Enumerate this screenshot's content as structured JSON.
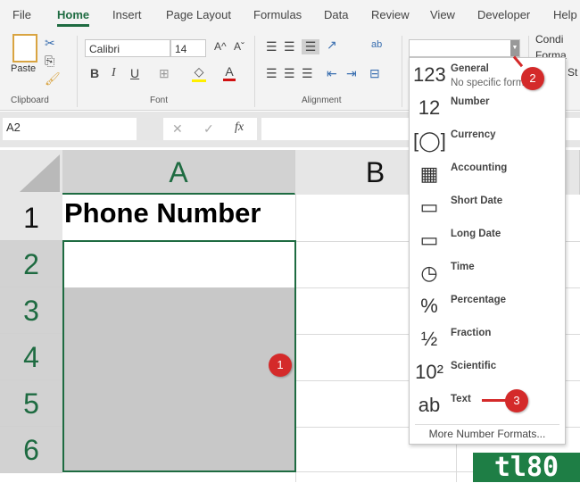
{
  "tabs": [
    "File",
    "Home",
    "Insert",
    "Page Layout",
    "Formulas",
    "Data",
    "Review",
    "View",
    "Developer",
    "Help"
  ],
  "clipboard": {
    "paste": "Paste",
    "label": "Clipboard"
  },
  "font": {
    "name": "Calibri",
    "size": "14",
    "label": "Font",
    "bold": "B",
    "italic": "I",
    "underline": "U",
    "grow": "A^",
    "shrink": "Aˇ",
    "color_glyph": "A"
  },
  "alignment": {
    "label": "Alignment",
    "wrap": "ab"
  },
  "styles": {
    "conditional": "Condi",
    "format": "Forma",
    "cell": "St"
  },
  "formula_bar": {
    "name_box": "A2",
    "cancel": "✕",
    "enter": "✓",
    "fx": "fx",
    "value": ""
  },
  "columns": [
    "A",
    "B"
  ],
  "rows": [
    "1",
    "2",
    "3",
    "4",
    "5",
    "6"
  ],
  "cells": {
    "A1": "Phone Number"
  },
  "number_format": {
    "value": "",
    "items": [
      {
        "icon": "general-123",
        "glyph": "123",
        "label": "General",
        "sub": "No specific format"
      },
      {
        "icon": "number-12",
        "glyph": "12",
        "label": "Number"
      },
      {
        "icon": "currency",
        "glyph": "[◯]",
        "label": "Currency"
      },
      {
        "icon": "accounting",
        "glyph": "▦",
        "label": "Accounting"
      },
      {
        "icon": "short-date",
        "glyph": "▭",
        "label": "Short Date"
      },
      {
        "icon": "long-date",
        "glyph": "▭",
        "label": "Long Date"
      },
      {
        "icon": "clock",
        "glyph": "◷",
        "label": "Time"
      },
      {
        "icon": "percent",
        "glyph": "%",
        "label": "Percentage"
      },
      {
        "icon": "fraction",
        "glyph": "½",
        "label": "Fraction"
      },
      {
        "icon": "scientific",
        "glyph": "10²",
        "label": "Scientific"
      },
      {
        "icon": "text-ab",
        "glyph": "ab",
        "label": "Text"
      }
    ],
    "more": "More Number Formats..."
  },
  "badges": [
    "1",
    "2",
    "3"
  ],
  "logo": "tl80",
  "colors": {
    "accent": "#1e6b41",
    "badge": "#d42a2a",
    "selection_fill": "#c8c8c8"
  }
}
